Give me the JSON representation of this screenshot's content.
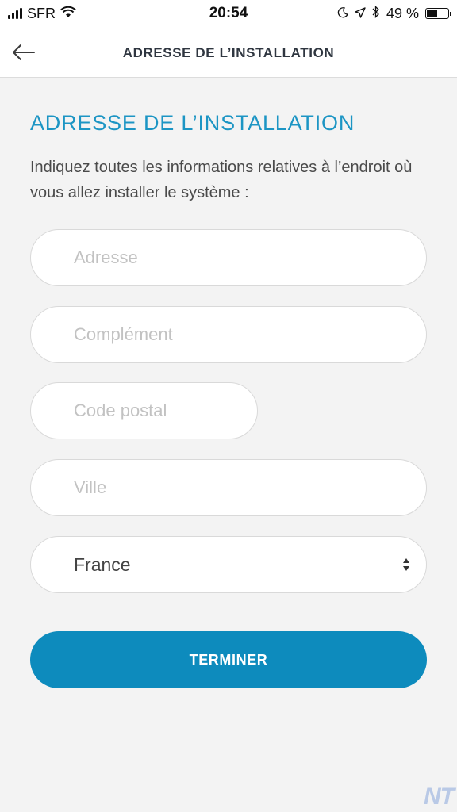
{
  "status_bar": {
    "carrier": "SFR",
    "time": "20:54",
    "battery_percent_label": "49 %",
    "battery_level": 0.49,
    "icons": [
      "signal-icon",
      "wifi-icon",
      "moon-icon",
      "location-icon",
      "bluetooth-icon",
      "battery-icon"
    ]
  },
  "header": {
    "title": "ADRESSE DE L’INSTALLATION",
    "back_icon": "back-arrow-icon"
  },
  "main": {
    "section_title": "ADRESSE DE L’INSTALLATION",
    "description": "Indiquez toutes les informations relatives à l’endroit où vous allez installer le système :",
    "fields": {
      "address_placeholder": "Adresse",
      "complement_placeholder": "Complément",
      "postal_code_placeholder": "Code postal",
      "city_placeholder": "Ville",
      "country_value": "France"
    },
    "submit_label": "TERMINER"
  },
  "watermark": "NT",
  "colors": {
    "accent": "#1c95c4",
    "button": "#0d8bbd",
    "background": "#f3f3f3"
  }
}
